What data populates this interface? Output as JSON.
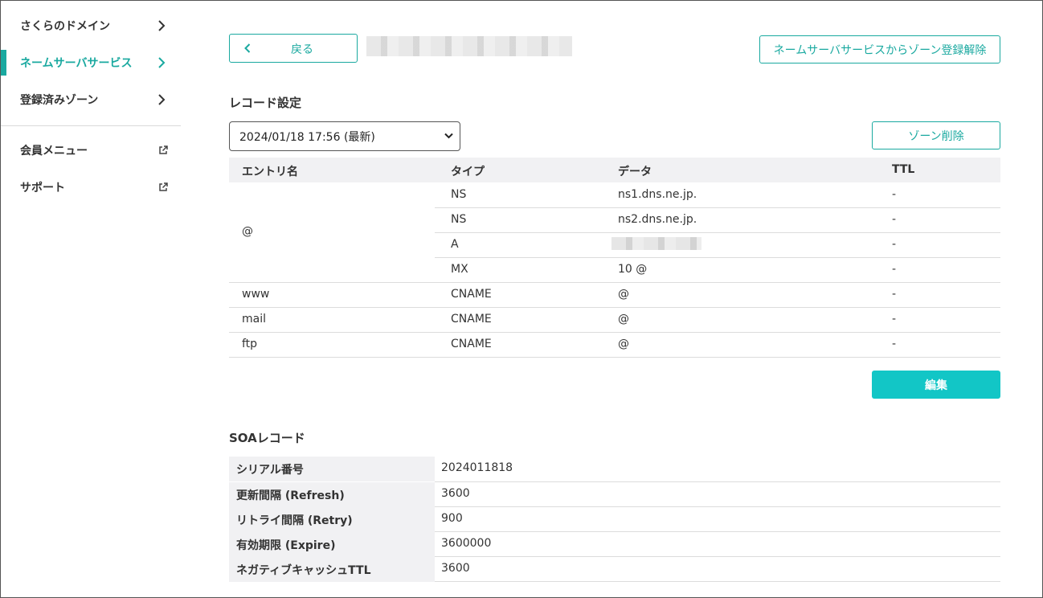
{
  "sidebar": {
    "items": [
      {
        "label": "さくらのドメイン"
      },
      {
        "label": "ネームサーバサービス"
      },
      {
        "label": "登録済みゾーン"
      },
      {
        "label": "会員メニュー"
      },
      {
        "label": "サポート"
      }
    ]
  },
  "header": {
    "back_label": "戻る",
    "unregister_label": "ネームサーバサービスからゾーン登録解除"
  },
  "records": {
    "title": "レコード設定",
    "version_selected": "2024/01/18 17:56 (最新)",
    "zone_delete_label": "ゾーン削除",
    "columns": [
      "エントリ名",
      "タイプ",
      "データ",
      "TTL"
    ],
    "group_entry": "@",
    "rows": [
      {
        "entry": "",
        "type": "NS",
        "data": "ns1.dns.ne.jp.",
        "ttl": "-"
      },
      {
        "entry": "",
        "type": "NS",
        "data": "ns2.dns.ne.jp.",
        "ttl": "-"
      },
      {
        "entry": "",
        "type": "A",
        "data": "",
        "ttl": "-"
      },
      {
        "entry": "",
        "type": "MX",
        "data": "10 @",
        "ttl": "-"
      },
      {
        "entry": "www",
        "type": "CNAME",
        "data": "@",
        "ttl": "-"
      },
      {
        "entry": "mail",
        "type": "CNAME",
        "data": "@",
        "ttl": "-"
      },
      {
        "entry": "ftp",
        "type": "CNAME",
        "data": "@",
        "ttl": "-"
      }
    ],
    "edit_label": "編集"
  },
  "soa": {
    "title": "SOAレコード",
    "rows": [
      {
        "key": "シリアル番号",
        "value": "2024011818"
      },
      {
        "key": "更新間隔 (Refresh)",
        "value": "3600"
      },
      {
        "key": "リトライ間隔 (Retry)",
        "value": "900"
      },
      {
        "key": "有効期限 (Expire)",
        "value": "3600000"
      },
      {
        "key": "ネガティブキャッシュTTL",
        "value": "3600"
      }
    ]
  },
  "colors": {
    "accent": "#1aa9a0",
    "edit_button": "#12c6c6",
    "header_bg": "#f1f1f3"
  },
  "icons": {
    "chevron": "chevron-right-icon",
    "external": "external-link-icon",
    "back": "chevron-left-icon"
  }
}
